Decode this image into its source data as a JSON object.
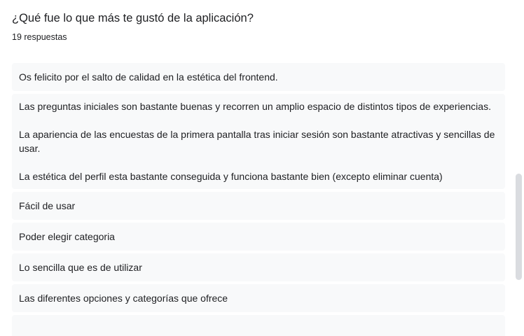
{
  "question": {
    "title": "¿Qué fue lo que más te gustó de la aplicación?",
    "response_count": "19 respuestas"
  },
  "responses": [
    {
      "paragraphs": [
        "Os felicito por el salto de calidad en la estética del frontend."
      ]
    },
    {
      "paragraphs": [
        "Las preguntas iniciales son bastante buenas y recorren un amplio espacio de distintos tipos de experiencias.",
        "La apariencia de las encuestas de la primera pantalla tras iniciar sesión son bastante atractivas y sencillas de usar.",
        "La estética del perfil esta bastante conseguida y funciona bastante bien (excepto eliminar cuenta)"
      ]
    },
    {
      "paragraphs": [
        "Fácil de usar"
      ]
    },
    {
      "paragraphs": [
        "Poder elegir categoria"
      ]
    },
    {
      "paragraphs": [
        "Lo sencilla que es de utilizar"
      ]
    },
    {
      "paragraphs": [
        "Las diferentes opciones y categorías que ofrece"
      ]
    },
    {
      "paragraphs": [
        ""
      ]
    }
  ],
  "colors": {
    "response_background": "#f8f9fa",
    "text": "#202124",
    "scrollbar": "#dadce0"
  }
}
